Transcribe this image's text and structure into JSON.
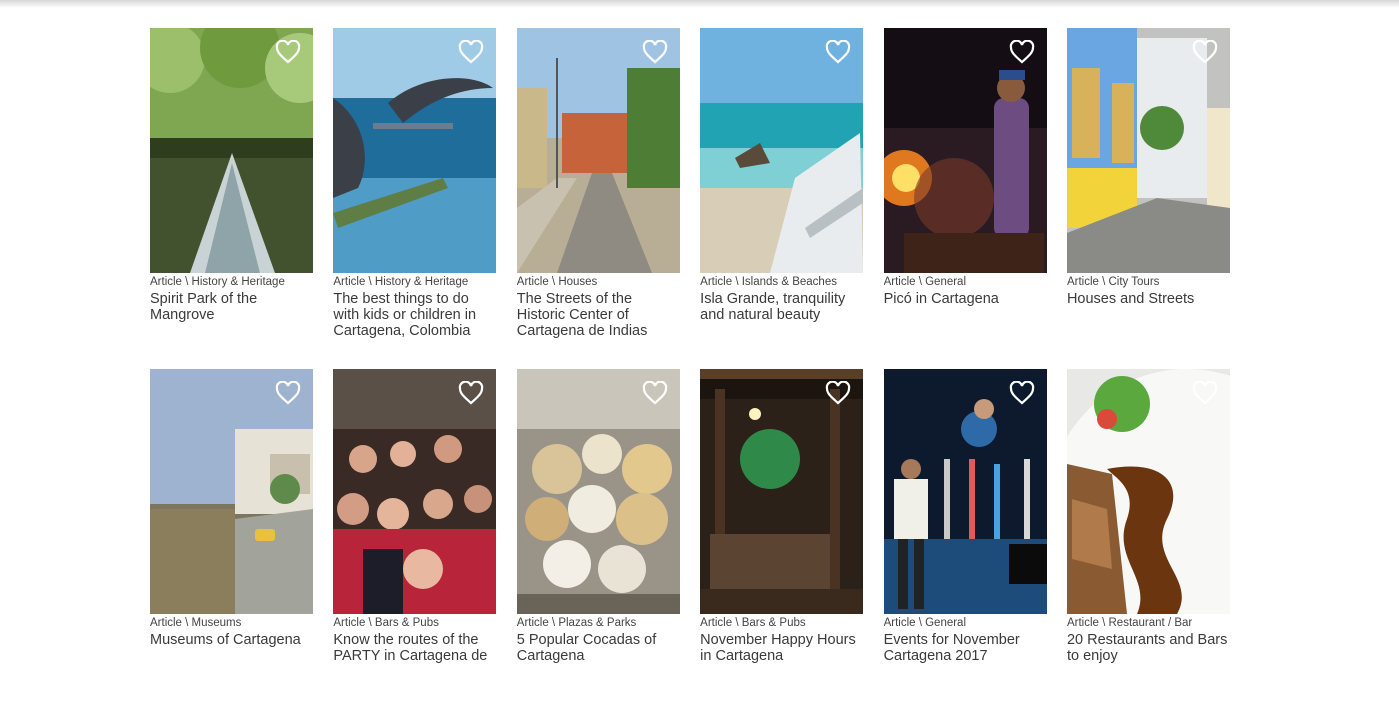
{
  "cards": [
    {
      "category": "Article \\ History & Heritage",
      "title": "Spirit Park of the Mangrove",
      "scene": "mangrove",
      "favorite_icon": "heart-outline-icon"
    },
    {
      "category": "Article \\ History & Heritage",
      "title": "The best things to do with kids or children in Cartagena, Colombia",
      "scene": "dolphin",
      "favorite_icon": "heart-outline-icon"
    },
    {
      "category": "Article \\ Houses",
      "title": "The Streets of the Historic Center of Cartagena de Indias",
      "scene": "street",
      "favorite_icon": "heart-outline-icon"
    },
    {
      "category": "Article \\ Islands & Beaches",
      "title": "Isla Grande, tranquility and natural beauty",
      "scene": "beach",
      "favorite_icon": "heart-outline-icon"
    },
    {
      "category": "Article \\ General",
      "title": "Picó in Cartagena",
      "scene": "concert",
      "favorite_icon": "heart-outline-icon"
    },
    {
      "category": "Article \\ City Tours",
      "title": "Houses and Streets",
      "scene": "houses",
      "favorite_icon": "heart-outline-icon"
    },
    {
      "category": "Article \\ Museums",
      "title": "Museums of Cartagena",
      "scene": "wall",
      "favorite_icon": "heart-outline-icon"
    },
    {
      "category": "Article \\ Bars & Pubs",
      "title": "Know the routes of the PARTY in Cartagena de",
      "scene": "party",
      "favorite_icon": "heart-outline-icon"
    },
    {
      "category": "Article \\ Plazas & Parks",
      "title": "5 Popular Cocadas of Cartagena",
      "scene": "cocadas",
      "favorite_icon": "heart-outline-icon"
    },
    {
      "category": "Article \\ Bars & Pubs",
      "title": "November Happy Hours in Cartagena",
      "scene": "bar",
      "favorite_icon": "heart-outline-icon"
    },
    {
      "category": "Article \\ General",
      "title": "Events for November Cartagena 2017",
      "scene": "band",
      "favorite_icon": "heart-outline-icon"
    },
    {
      "category": "Article \\ Restaurant / Bar",
      "title": "20 Restaurants and Bars to enjoy",
      "scene": "food",
      "favorite_icon": "heart-outline-icon"
    }
  ]
}
